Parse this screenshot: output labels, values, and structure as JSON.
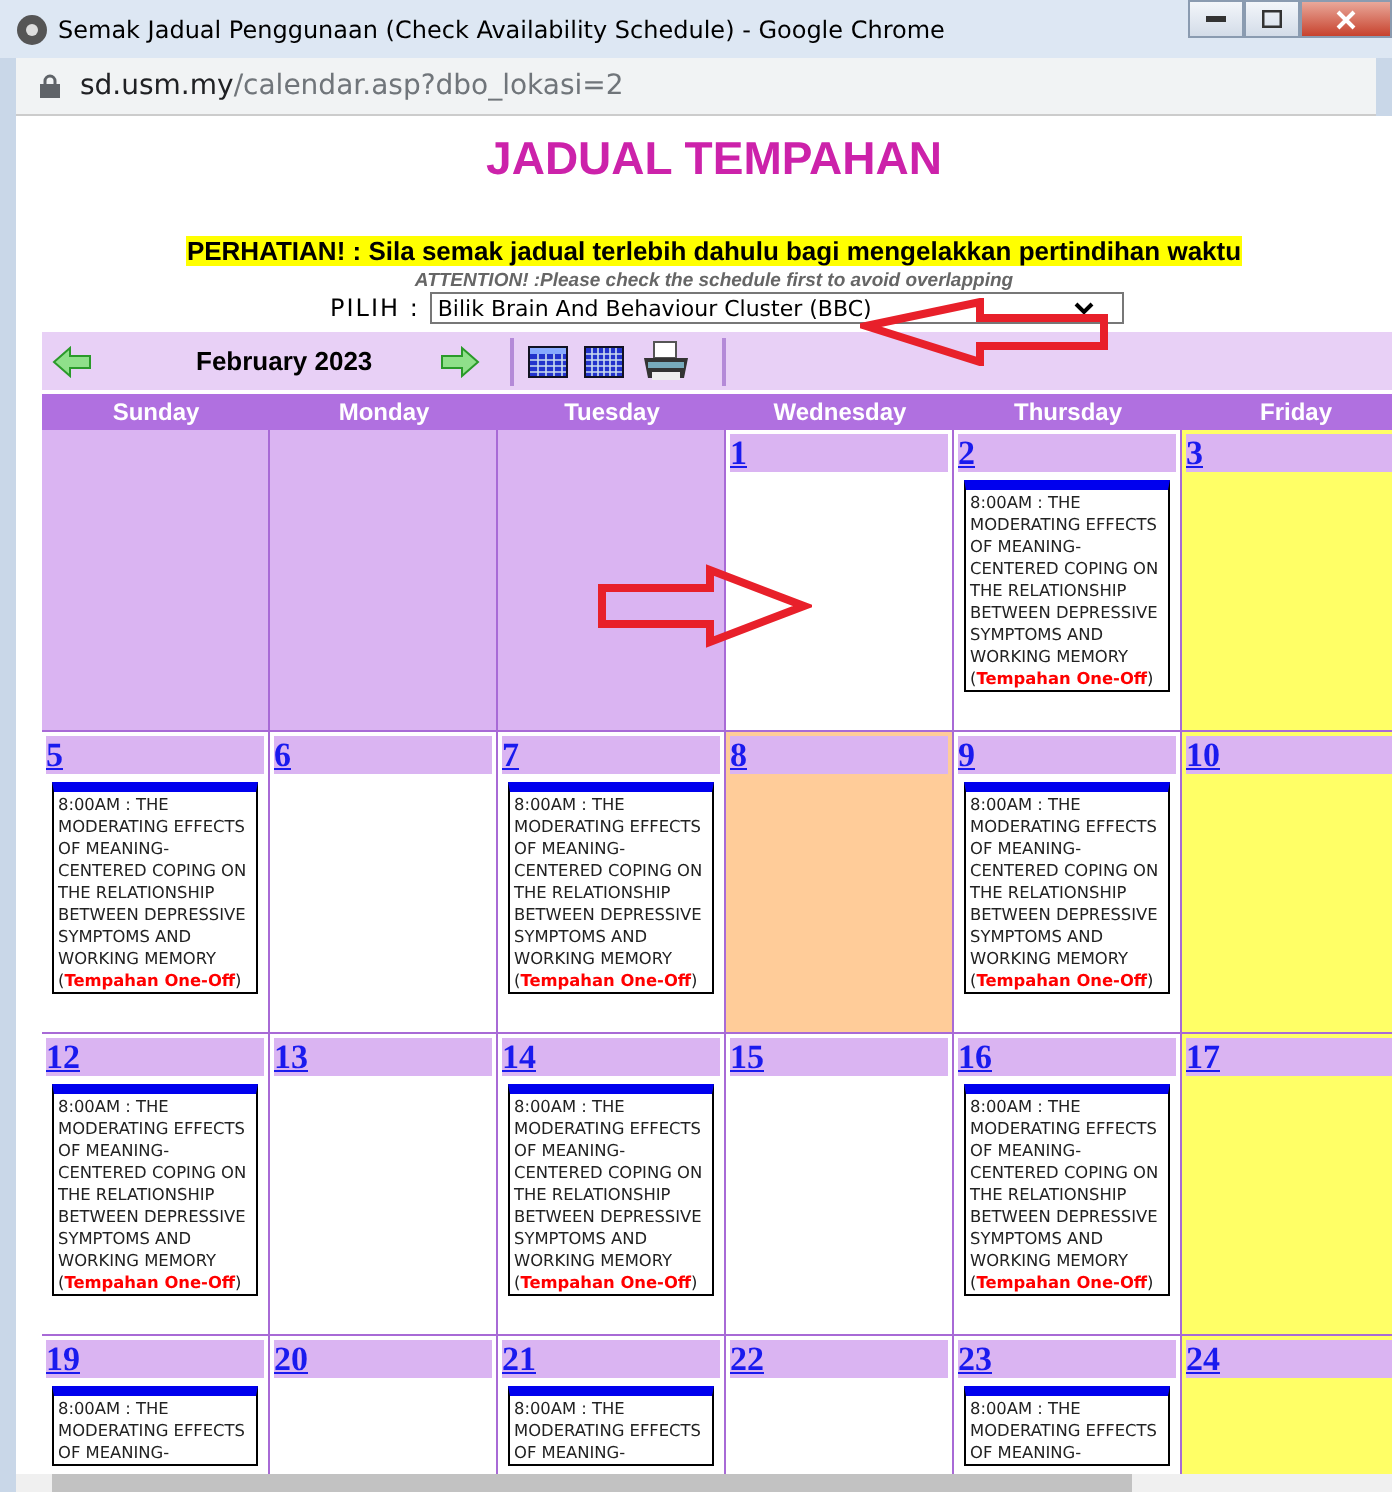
{
  "window": {
    "title": "Semak Jadual Penggunaan (Check Availability Schedule) - Google Chrome"
  },
  "address_bar": {
    "domain": "sd.usm.my",
    "path": "/calendar.asp?dbo_lokasi=2"
  },
  "page": {
    "heading": "JADUAL TEMPAHAN",
    "notice": "PERHATIAN! : Sila semak jadual terlebih dahulu bagi mengelakkan pertindihan waktu",
    "notice_en": "ATTENTION! :Please check the schedule first to avoid overlapping",
    "select_label": "PILIH :",
    "select_value": "Bilik Brain And Behaviour Cluster (BBC)"
  },
  "calendar": {
    "month_label": "February 2023",
    "weekdays": [
      "Sunday",
      "Monday",
      "Tuesday",
      "Wednesday",
      "Thursday",
      "Friday"
    ],
    "weeks": [
      [
        {
          "kind": "empty"
        },
        {
          "kind": "empty"
        },
        {
          "kind": "empty"
        },
        {
          "kind": "plain",
          "day": "1"
        },
        {
          "kind": "plain",
          "day": "2",
          "events": [
            {
              "text": "8:00AM : THE MODERATING EFFECTS OF MEANING-CENTERED COPING ON THE RELATIONSHIP BETWEEN DEPRESSIVE SYMPTOMS AND WORKING MEMORY (**Tempahan One-Off**)"
            }
          ]
        },
        {
          "kind": "weekend",
          "day": "3"
        }
      ],
      [
        {
          "kind": "plain",
          "day": "5",
          "events": [
            {
              "text": "8:00AM : THE MODERATING EFFECTS OF MEANING-CENTERED COPING ON THE RELATIONSHIP BETWEEN DEPRESSIVE SYMPTOMS AND WORKING MEMORY (**Tempahan One-Off**)"
            }
          ]
        },
        {
          "kind": "plain",
          "day": "6"
        },
        {
          "kind": "plain",
          "day": "7",
          "events": [
            {
              "text": "8:00AM : THE MODERATING EFFECTS OF MEANING-CENTERED COPING ON THE RELATIONSHIP BETWEEN DEPRESSIVE SYMPTOMS AND WORKING MEMORY (**Tempahan One-Off**)"
            }
          ]
        },
        {
          "kind": "today",
          "day": "8"
        },
        {
          "kind": "plain",
          "day": "9",
          "events": [
            {
              "text": "8:00AM : THE MODERATING EFFECTS OF MEANING-CENTERED COPING ON THE RELATIONSHIP BETWEEN DEPRESSIVE SYMPTOMS AND WORKING MEMORY (**Tempahan One-Off**)"
            }
          ]
        },
        {
          "kind": "weekend",
          "day": "10"
        }
      ],
      [
        {
          "kind": "plain",
          "day": "12",
          "events": [
            {
              "text": "8:00AM : THE MODERATING EFFECTS OF MEANING-CENTERED COPING ON THE RELATIONSHIP BETWEEN DEPRESSIVE SYMPTOMS AND WORKING MEMORY (**Tempahan One-Off**)"
            }
          ]
        },
        {
          "kind": "plain",
          "day": "13"
        },
        {
          "kind": "plain",
          "day": "14",
          "events": [
            {
              "text": "8:00AM : THE MODERATING EFFECTS OF MEANING-CENTERED COPING ON THE RELATIONSHIP BETWEEN DEPRESSIVE SYMPTOMS AND WORKING MEMORY (**Tempahan One-Off**)"
            }
          ]
        },
        {
          "kind": "plain",
          "day": "15"
        },
        {
          "kind": "plain",
          "day": "16",
          "events": [
            {
              "text": "8:00AM : THE MODERATING EFFECTS OF MEANING-CENTERED COPING ON THE RELATIONSHIP BETWEEN DEPRESSIVE SYMPTOMS AND WORKING MEMORY (**Tempahan One-Off**)"
            }
          ]
        },
        {
          "kind": "weekend",
          "day": "17"
        }
      ],
      [
        {
          "kind": "plain",
          "day": "19",
          "events": [
            {
              "text": "8:00AM : THE MODERATING EFFECTS OF MEANING-"
            }
          ]
        },
        {
          "kind": "plain",
          "day": "20"
        },
        {
          "kind": "plain",
          "day": "21",
          "events": [
            {
              "text": "8:00AM : THE MODERATING EFFECTS OF MEANING-"
            }
          ]
        },
        {
          "kind": "plain",
          "day": "22"
        },
        {
          "kind": "plain",
          "day": "23",
          "events": [
            {
              "text": "8:00AM : THE MODERATING EFFECTS OF MEANING-"
            }
          ]
        },
        {
          "kind": "weekend",
          "day": "24"
        }
      ]
    ]
  }
}
